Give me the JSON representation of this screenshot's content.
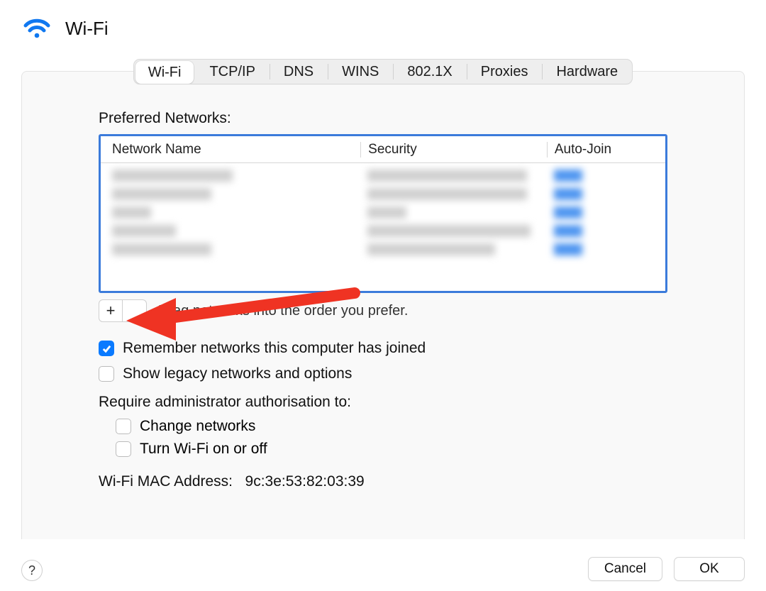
{
  "header": {
    "title": "Wi-Fi"
  },
  "tabs": [
    "Wi-Fi",
    "TCP/IP",
    "DNS",
    "WINS",
    "802.1X",
    "Proxies",
    "Hardware"
  ],
  "active_tab_index": 0,
  "preferred_networks": {
    "label": "Preferred Networks:",
    "columns": {
      "name": "Network Name",
      "security": "Security",
      "auto_join": "Auto-Join"
    },
    "rows_placeholder_count": 5
  },
  "buttons": {
    "add": "+",
    "remove": "−"
  },
  "drag_hint": "Drag networks into the order you prefer.",
  "checkboxes": {
    "remember": {
      "label": "Remember networks this computer has joined",
      "checked": true
    },
    "legacy": {
      "label": "Show legacy networks and options",
      "checked": false
    }
  },
  "require_admin": {
    "label": "Require administrator authorisation to:",
    "options": {
      "change_networks": {
        "label": "Change networks",
        "checked": false
      },
      "toggle_wifi": {
        "label": "Turn Wi-Fi on or off",
        "checked": false
      }
    }
  },
  "mac_address": {
    "label": "Wi-Fi MAC Address:",
    "value": "9c:3e:53:82:03:39"
  },
  "footer": {
    "cancel": "Cancel",
    "ok": "OK",
    "help": "?"
  }
}
